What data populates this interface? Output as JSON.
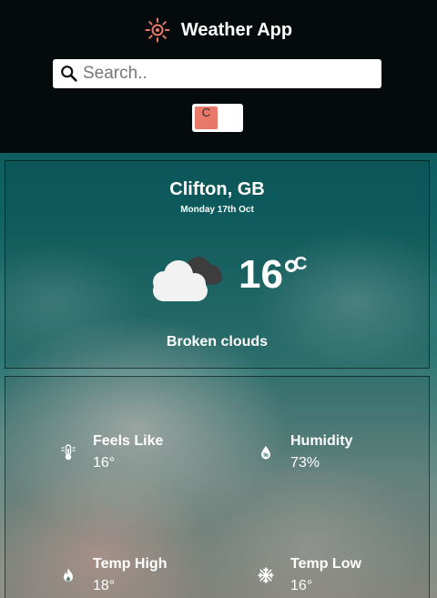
{
  "app": {
    "title": "Weather App",
    "logo_icon": "sun-icon",
    "accent": "#e8786a"
  },
  "search": {
    "placeholder": "Search..",
    "icon": "search-icon"
  },
  "unit_toggle": {
    "selected": "C"
  },
  "current": {
    "location": "Clifton, GB",
    "date": "Monday 17th Oct",
    "icon": "broken-clouds-icon",
    "temperature": "16°",
    "unit": "C",
    "description": "Broken clouds"
  },
  "details": [
    {
      "label": "Feels Like",
      "value": "16°",
      "icon": "thermometer-icon"
    },
    {
      "label": "Humidity",
      "value": "73%",
      "icon": "droplet-icon"
    },
    {
      "label": "Temp High",
      "value": "18°",
      "icon": "flame-icon"
    },
    {
      "label": "Temp Low",
      "value": "16°",
      "icon": "snowflake-icon"
    }
  ]
}
